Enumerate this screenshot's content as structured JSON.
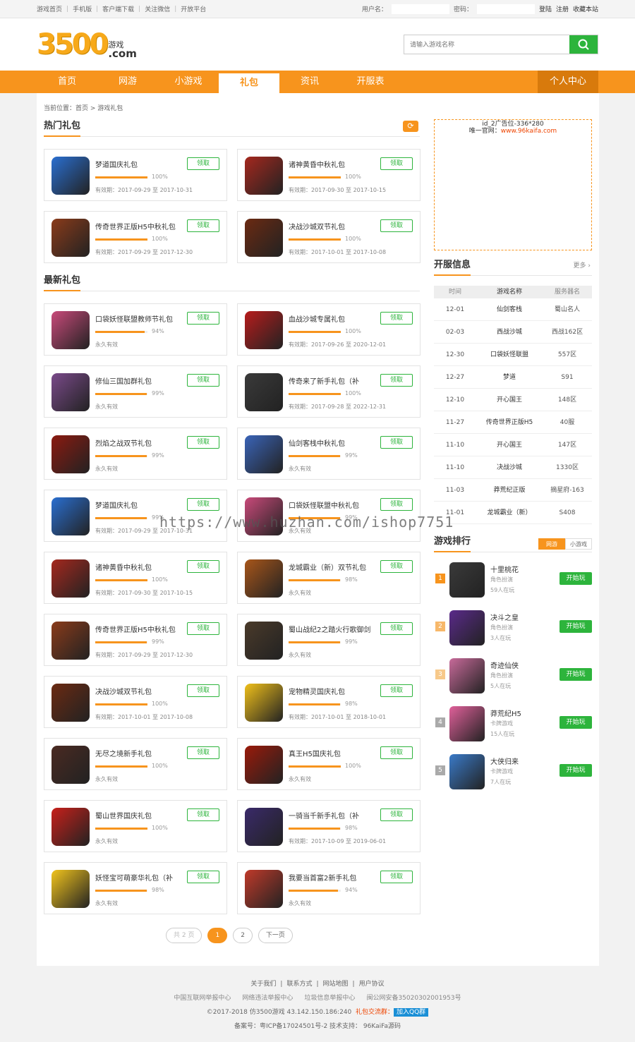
{
  "topbar": {
    "links": [
      "游戏首页",
      "手机版",
      "客户端下载",
      "关注微信",
      "开放平台"
    ],
    "user_label": "用户名：",
    "pwd_label": "密码：",
    "login": "登陆",
    "register": "注册",
    "fav": "收藏本站"
  },
  "header": {
    "logo_num": "3500",
    "logo_text": "游戏",
    "logo_com": ".com",
    "search_placeholder": "请输入游戏名称"
  },
  "nav": {
    "items": [
      "首页",
      "网游",
      "小游戏",
      "礼包",
      "资讯",
      "开服表"
    ],
    "active": "礼包",
    "user_center": "个人中心"
  },
  "crumb": "当前位置：首页 > 游戏礼包",
  "hot": {
    "title": "热门礼包",
    "refresh": "⟳"
  },
  "latest": {
    "title": "最新礼包"
  },
  "get_label": "领取",
  "hot_gifts": [
    {
      "name": "梦道国庆礼包",
      "pct": "100%",
      "p": 100,
      "exp": "有效期：2017-09-29 至 2017-10-31",
      "color": "#2a6fd1"
    },
    {
      "name": "诸神黄昏中秋礼包",
      "pct": "100%",
      "p": 100,
      "exp": "有效期：2017-09-30 至 2017-10-15",
      "color": "#a5281e"
    },
    {
      "name": "传奇世界正版H5中秋礼包",
      "pct": "100%",
      "p": 100,
      "exp": "有效期：2017-09-29 至 2017-12-30",
      "color": "#8a3b1a"
    },
    {
      "name": "决战沙城双节礼包",
      "pct": "100%",
      "p": 100,
      "exp": "有效期：2017-10-01 至 2017-10-08",
      "color": "#6b2a12"
    }
  ],
  "new_gifts": [
    {
      "name": "口袋妖怪联盟教师节礼包",
      "pct": "94%",
      "p": 94,
      "exp": "永久有效",
      "color": "#c94a7a"
    },
    {
      "name": "血战沙城专属礼包",
      "pct": "100%",
      "p": 100,
      "exp": "有效期：2017-09-26 至 2020-12-01",
      "color": "#b71c1c"
    },
    {
      "name": "修仙三国加群礼包",
      "pct": "99%",
      "p": 99,
      "exp": "永久有效",
      "color": "#7a4a8a"
    },
    {
      "name": "传奇来了新手礼包（补",
      "pct": "100%",
      "p": 100,
      "exp": "有效期：2017-09-28 至 2022-12-31",
      "color": "#3a3a3a"
    },
    {
      "name": "烈焰之战双节礼包",
      "pct": "99%",
      "p": 99,
      "exp": "永久有效",
      "color": "#8b1a10"
    },
    {
      "name": "仙剑客栈中秋礼包",
      "pct": "99%",
      "p": 99,
      "exp": "永久有效",
      "color": "#3a64b8"
    },
    {
      "name": "梦道国庆礼包",
      "pct": "99%",
      "p": 99,
      "exp": "有效期：2017-09-29 至 2017-10-31",
      "color": "#2a6fd1"
    },
    {
      "name": "口袋妖怪联盟中秋礼包",
      "pct": "99%",
      "p": 99,
      "exp": "永久有效",
      "color": "#c94a7a"
    },
    {
      "name": "诸神黄昏中秋礼包",
      "pct": "100%",
      "p": 100,
      "exp": "有效期：2017-09-30 至 2017-10-15",
      "color": "#a5281e"
    },
    {
      "name": "龙城霸业（新）双节礼包",
      "pct": "98%",
      "p": 98,
      "exp": "永久有效",
      "color": "#a8561a"
    },
    {
      "name": "传奇世界正版H5中秋礼包",
      "pct": "99%",
      "p": 99,
      "exp": "有效期：2017-09-29 至 2017-12-30",
      "color": "#8a3b1a"
    },
    {
      "name": "蜀山战纪2之踏火行歌御剑",
      "pct": "99%",
      "p": 99,
      "exp": "永久有效",
      "color": "#4a3a2a"
    },
    {
      "name": "决战沙城双节礼包",
      "pct": "100%",
      "p": 100,
      "exp": "有效期：2017-10-01 至 2017-10-08",
      "color": "#6b2a12"
    },
    {
      "name": "宠物精灵国庆礼包",
      "pct": "98%",
      "p": 98,
      "exp": "有效期：2017-10-01 至 2018-10-01",
      "color": "#f0c01a"
    },
    {
      "name": "无尽之境新手礼包",
      "pct": "100%",
      "p": 100,
      "exp": "永久有效",
      "color": "#4a2a22"
    },
    {
      "name": "真王H5国庆礼包",
      "pct": "100%",
      "p": 100,
      "exp": "永久有效",
      "color": "#9a1a0a"
    },
    {
      "name": "蜀山世界国庆礼包",
      "pct": "100%",
      "p": 100,
      "exp": "永久有效",
      "color": "#c8201a"
    },
    {
      "name": "一骑当千新手礼包（补",
      "pct": "98%",
      "p": 98,
      "exp": "有效期：2017-10-09 至 2019-06-01",
      "color": "#3a2a6a"
    },
    {
      "name": "妖怪宝可萌豪华礼包（补",
      "pct": "98%",
      "p": 98,
      "exp": "永久有效",
      "color": "#f2c41c"
    },
    {
      "name": "我要当首富2新手礼包",
      "pct": "94%",
      "p": 94,
      "exp": "永久有效",
      "color": "#c03a2a"
    }
  ],
  "pager": {
    "total": "共 2 页",
    "pages": [
      "1",
      "2"
    ],
    "next": "下一页"
  },
  "ad": {
    "line1": "id_2广告位-336*280",
    "line2": "唯一官网：",
    "url": "www.96kaifa.com"
  },
  "servers": {
    "title": "开服信息",
    "more": "更多 ›",
    "headers": [
      "时间",
      "游戏名称",
      "服务器名"
    ],
    "rows": [
      [
        "12-01",
        "仙剑客栈",
        "蜀山名人"
      ],
      [
        "02-03",
        "西战沙城",
        "西战162区"
      ],
      [
        "12-30",
        "口袋妖怪联盟",
        "557区"
      ],
      [
        "12-27",
        "梦道",
        "S91"
      ],
      [
        "12-10",
        "开心国王",
        "148区"
      ],
      [
        "11-27",
        "传奇世界正版H5",
        "40服"
      ],
      [
        "11-10",
        "开心国王",
        "147区"
      ],
      [
        "11-10",
        "决战沙城",
        "1330区"
      ],
      [
        "11-03",
        "莽荒纪正版",
        "摘星府-163"
      ],
      [
        "11-01",
        "龙城霸业（新）",
        "S408"
      ]
    ]
  },
  "ranking": {
    "title": "游戏排行",
    "tabs": [
      "网游",
      "小游戏"
    ],
    "play": "开始玩",
    "items": [
      {
        "no": "1",
        "name": "十里桃花",
        "type": "角色扮演",
        "online": "59人在玩",
        "color": "#f7941d",
        "ic": "#3a3a3a"
      },
      {
        "no": "2",
        "name": "决斗之皇",
        "type": "角色扮演",
        "online": "3人在玩",
        "color": "#f7b86a",
        "ic": "#5a2a8a"
      },
      {
        "no": "3",
        "name": "奇迹仙侠",
        "type": "角色扮演",
        "online": "5人在玩",
        "color": "#f7c98a",
        "ic": "#c86a9a"
      },
      {
        "no": "4",
        "name": "莽荒纪H5",
        "type": "卡牌游戏",
        "online": "15人在玩",
        "color": "#aaa",
        "ic": "#e0609a"
      },
      {
        "no": "5",
        "name": "大侠归来",
        "type": "卡牌游戏",
        "online": "7人在玩",
        "color": "#aaa",
        "ic": "#3a7ac8"
      }
    ]
  },
  "footer": {
    "links": [
      "关于我们",
      "联系方式",
      "网站地图",
      "用户协议"
    ],
    "badges": [
      "中国互联网举报中心",
      "网络违法举报中心",
      "垃圾信息举报中心",
      "闽公网安备35020302001953号"
    ],
    "copy": "©2017-2018  仿3500游戏  43.142.150.186:240",
    "group_label": "礼包交流群：",
    "qq": "加入QQ群",
    "icp": "备案号：粤ICP备17024501号-2  技术支持：  96KaiFa源码"
  },
  "watermark": "https://www.huzhan.com/ishop7751"
}
